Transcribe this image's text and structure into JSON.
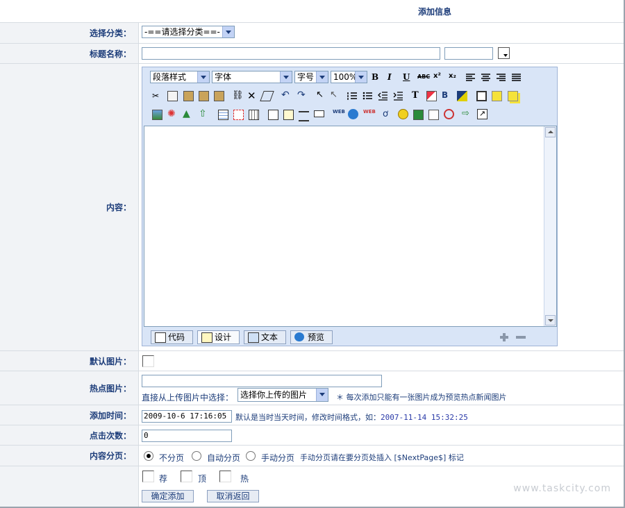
{
  "page_title": "添加信息",
  "fields": {
    "category": {
      "label": "选择分类：",
      "value": "-==请选择分类==-"
    },
    "title": {
      "label": "标题名称：",
      "value": "",
      "color_value": ""
    },
    "content": {
      "label": "内容：",
      "toolbar": {
        "paragraph": "段落样式",
        "font": "字体",
        "size": "字号",
        "zoom": "100%"
      },
      "tabs": [
        "代码",
        "设计",
        "文本",
        "预览"
      ]
    },
    "default_image": {
      "label": "默认图片："
    },
    "hot_image": {
      "label": "热点图片：",
      "value": "",
      "pick_text": "直接从上传图片中选择：",
      "pick_value": "选择你上传的图片",
      "note": "＊ 每次添加只能有一张图片成为预览热点新闻图片"
    },
    "add_time": {
      "label": "添加时间：",
      "value": "2009-10-6 17:16:05",
      "hint": "默认是当时当天时间，修改时间格式，如：",
      "example": "2007-11-14 15:32:25"
    },
    "hits": {
      "label": "点击次数：",
      "value": "0"
    },
    "paging": {
      "label": "内容分页：",
      "options": [
        "不分页",
        "自动分页",
        "手动分页"
      ],
      "selected": "不分页",
      "hint": "手动分页请在要分页处插入 [$NextPage$] 标记"
    },
    "flags": [
      "荐",
      "顶",
      "热"
    ]
  },
  "buttons": {
    "submit": "确定添加",
    "cancel": "取消返回"
  },
  "watermark": "www.taskcity.com",
  "colors": {
    "label_text": "#1d3d7a",
    "label_bg": "#f1f3f6",
    "editor_bg": "#d9e5f7",
    "link_blue": "#1d3d7a"
  }
}
